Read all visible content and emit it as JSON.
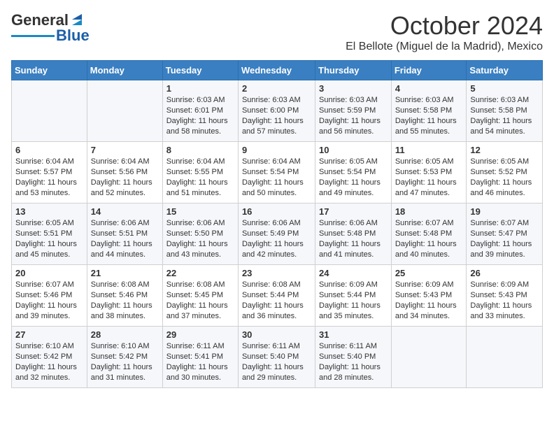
{
  "logo": {
    "text_general": "General",
    "text_blue": "Blue"
  },
  "header": {
    "month": "October 2024",
    "location": "El Bellote (Miguel de la Madrid), Mexico"
  },
  "days_of_week": [
    "Sunday",
    "Monday",
    "Tuesday",
    "Wednesday",
    "Thursday",
    "Friday",
    "Saturday"
  ],
  "weeks": [
    [
      {
        "day": "",
        "info": ""
      },
      {
        "day": "",
        "info": ""
      },
      {
        "day": "1",
        "info": "Sunrise: 6:03 AM\nSunset: 6:01 PM\nDaylight: 11 hours and 58 minutes."
      },
      {
        "day": "2",
        "info": "Sunrise: 6:03 AM\nSunset: 6:00 PM\nDaylight: 11 hours and 57 minutes."
      },
      {
        "day": "3",
        "info": "Sunrise: 6:03 AM\nSunset: 5:59 PM\nDaylight: 11 hours and 56 minutes."
      },
      {
        "day": "4",
        "info": "Sunrise: 6:03 AM\nSunset: 5:58 PM\nDaylight: 11 hours and 55 minutes."
      },
      {
        "day": "5",
        "info": "Sunrise: 6:03 AM\nSunset: 5:58 PM\nDaylight: 11 hours and 54 minutes."
      }
    ],
    [
      {
        "day": "6",
        "info": "Sunrise: 6:04 AM\nSunset: 5:57 PM\nDaylight: 11 hours and 53 minutes."
      },
      {
        "day": "7",
        "info": "Sunrise: 6:04 AM\nSunset: 5:56 PM\nDaylight: 11 hours and 52 minutes."
      },
      {
        "day": "8",
        "info": "Sunrise: 6:04 AM\nSunset: 5:55 PM\nDaylight: 11 hours and 51 minutes."
      },
      {
        "day": "9",
        "info": "Sunrise: 6:04 AM\nSunset: 5:54 PM\nDaylight: 11 hours and 50 minutes."
      },
      {
        "day": "10",
        "info": "Sunrise: 6:05 AM\nSunset: 5:54 PM\nDaylight: 11 hours and 49 minutes."
      },
      {
        "day": "11",
        "info": "Sunrise: 6:05 AM\nSunset: 5:53 PM\nDaylight: 11 hours and 47 minutes."
      },
      {
        "day": "12",
        "info": "Sunrise: 6:05 AM\nSunset: 5:52 PM\nDaylight: 11 hours and 46 minutes."
      }
    ],
    [
      {
        "day": "13",
        "info": "Sunrise: 6:05 AM\nSunset: 5:51 PM\nDaylight: 11 hours and 45 minutes."
      },
      {
        "day": "14",
        "info": "Sunrise: 6:06 AM\nSunset: 5:51 PM\nDaylight: 11 hours and 44 minutes."
      },
      {
        "day": "15",
        "info": "Sunrise: 6:06 AM\nSunset: 5:50 PM\nDaylight: 11 hours and 43 minutes."
      },
      {
        "day": "16",
        "info": "Sunrise: 6:06 AM\nSunset: 5:49 PM\nDaylight: 11 hours and 42 minutes."
      },
      {
        "day": "17",
        "info": "Sunrise: 6:06 AM\nSunset: 5:48 PM\nDaylight: 11 hours and 41 minutes."
      },
      {
        "day": "18",
        "info": "Sunrise: 6:07 AM\nSunset: 5:48 PM\nDaylight: 11 hours and 40 minutes."
      },
      {
        "day": "19",
        "info": "Sunrise: 6:07 AM\nSunset: 5:47 PM\nDaylight: 11 hours and 39 minutes."
      }
    ],
    [
      {
        "day": "20",
        "info": "Sunrise: 6:07 AM\nSunset: 5:46 PM\nDaylight: 11 hours and 39 minutes."
      },
      {
        "day": "21",
        "info": "Sunrise: 6:08 AM\nSunset: 5:46 PM\nDaylight: 11 hours and 38 minutes."
      },
      {
        "day": "22",
        "info": "Sunrise: 6:08 AM\nSunset: 5:45 PM\nDaylight: 11 hours and 37 minutes."
      },
      {
        "day": "23",
        "info": "Sunrise: 6:08 AM\nSunset: 5:44 PM\nDaylight: 11 hours and 36 minutes."
      },
      {
        "day": "24",
        "info": "Sunrise: 6:09 AM\nSunset: 5:44 PM\nDaylight: 11 hours and 35 minutes."
      },
      {
        "day": "25",
        "info": "Sunrise: 6:09 AM\nSunset: 5:43 PM\nDaylight: 11 hours and 34 minutes."
      },
      {
        "day": "26",
        "info": "Sunrise: 6:09 AM\nSunset: 5:43 PM\nDaylight: 11 hours and 33 minutes."
      }
    ],
    [
      {
        "day": "27",
        "info": "Sunrise: 6:10 AM\nSunset: 5:42 PM\nDaylight: 11 hours and 32 minutes."
      },
      {
        "day": "28",
        "info": "Sunrise: 6:10 AM\nSunset: 5:42 PM\nDaylight: 11 hours and 31 minutes."
      },
      {
        "day": "29",
        "info": "Sunrise: 6:11 AM\nSunset: 5:41 PM\nDaylight: 11 hours and 30 minutes."
      },
      {
        "day": "30",
        "info": "Sunrise: 6:11 AM\nSunset: 5:40 PM\nDaylight: 11 hours and 29 minutes."
      },
      {
        "day": "31",
        "info": "Sunrise: 6:11 AM\nSunset: 5:40 PM\nDaylight: 11 hours and 28 minutes."
      },
      {
        "day": "",
        "info": ""
      },
      {
        "day": "",
        "info": ""
      }
    ]
  ]
}
